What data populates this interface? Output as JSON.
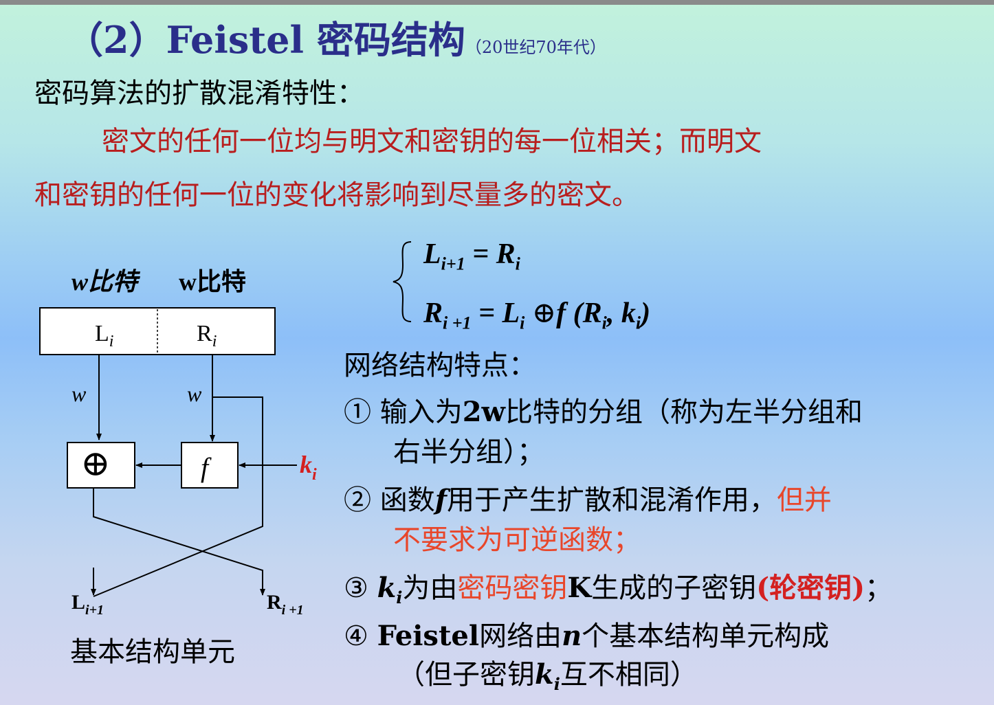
{
  "title": {
    "prefix": "（2）",
    "main": "Feistel 密码结构",
    "note": "（20世纪70年代）"
  },
  "diffusion": {
    "heading": "密码算法的扩散混淆特性：",
    "line1": "密文的任何一位均与明文和密钥的每一位相关；而明文",
    "line2": "和密钥的任何一位的变化将影响到尽量多的密文。"
  },
  "diagram": {
    "bits_left": "w比特",
    "bits_right": "w比特",
    "box_left": "L",
    "box_left_sub": "i",
    "box_right": "R",
    "box_right_sub": "i",
    "wire_left": "w",
    "wire_right": "w",
    "xor_symbol": "⊕",
    "func": "f",
    "key": "k",
    "key_sub": "i",
    "out_left": "L",
    "out_left_sub": "i+1",
    "out_right": "R",
    "out_right_sub": "i +1",
    "caption": "基本结构单元"
  },
  "equations": {
    "eq1_lhs": "L",
    "eq1_lhs_sub": "i+1",
    "eq1_rhs": "= R",
    "eq1_rhs_sub": "i",
    "eq2_lhs": "R",
    "eq2_lhs_sub": "i +1",
    "eq2_mid": "= L",
    "eq2_mid_sub": "i",
    "eq2_op": "⊕",
    "eq2_f": "f (R",
    "eq2_f_sub": "i",
    "eq2_comma": ", k",
    "eq2_k_sub": "i",
    "eq2_close": ")"
  },
  "features": {
    "heading": "网络结构特点：",
    "item1_a": "① 输入为",
    "item1_b": "2w",
    "item1_c": "比特的分组（称为左半分组和",
    "item1_d": "右半分组）；",
    "item2_a": "② 函数",
    "item2_f": "f",
    "item2_b": "用于产生扩散和混淆作用，",
    "item2_red1": "但并",
    "item2_red2": "不要求为可逆函数；",
    "item3_num": "③",
    "item3_k": "k",
    "item3_sub": "i",
    "item3_a": "为由",
    "item3_red": "密码密钥",
    "item3_K": "K",
    "item3_b": "生成的子密钥",
    "item3_red2": "(轮密钥)",
    "item3_end": "；",
    "item4_a": "④ ",
    "item4_feistel": "Feistel",
    "item4_b": "网络由",
    "item4_n": "n",
    "item4_c": "个基本结构单元构成",
    "item4_d": "（但子密钥",
    "item4_k": "k",
    "item4_sub": "i",
    "item4_e": "互不相同）"
  },
  "colors": {
    "title": "#2a2e8a",
    "red_text": "#b81e1e",
    "highlight": "#e8462a",
    "key_label": "#d42020"
  }
}
